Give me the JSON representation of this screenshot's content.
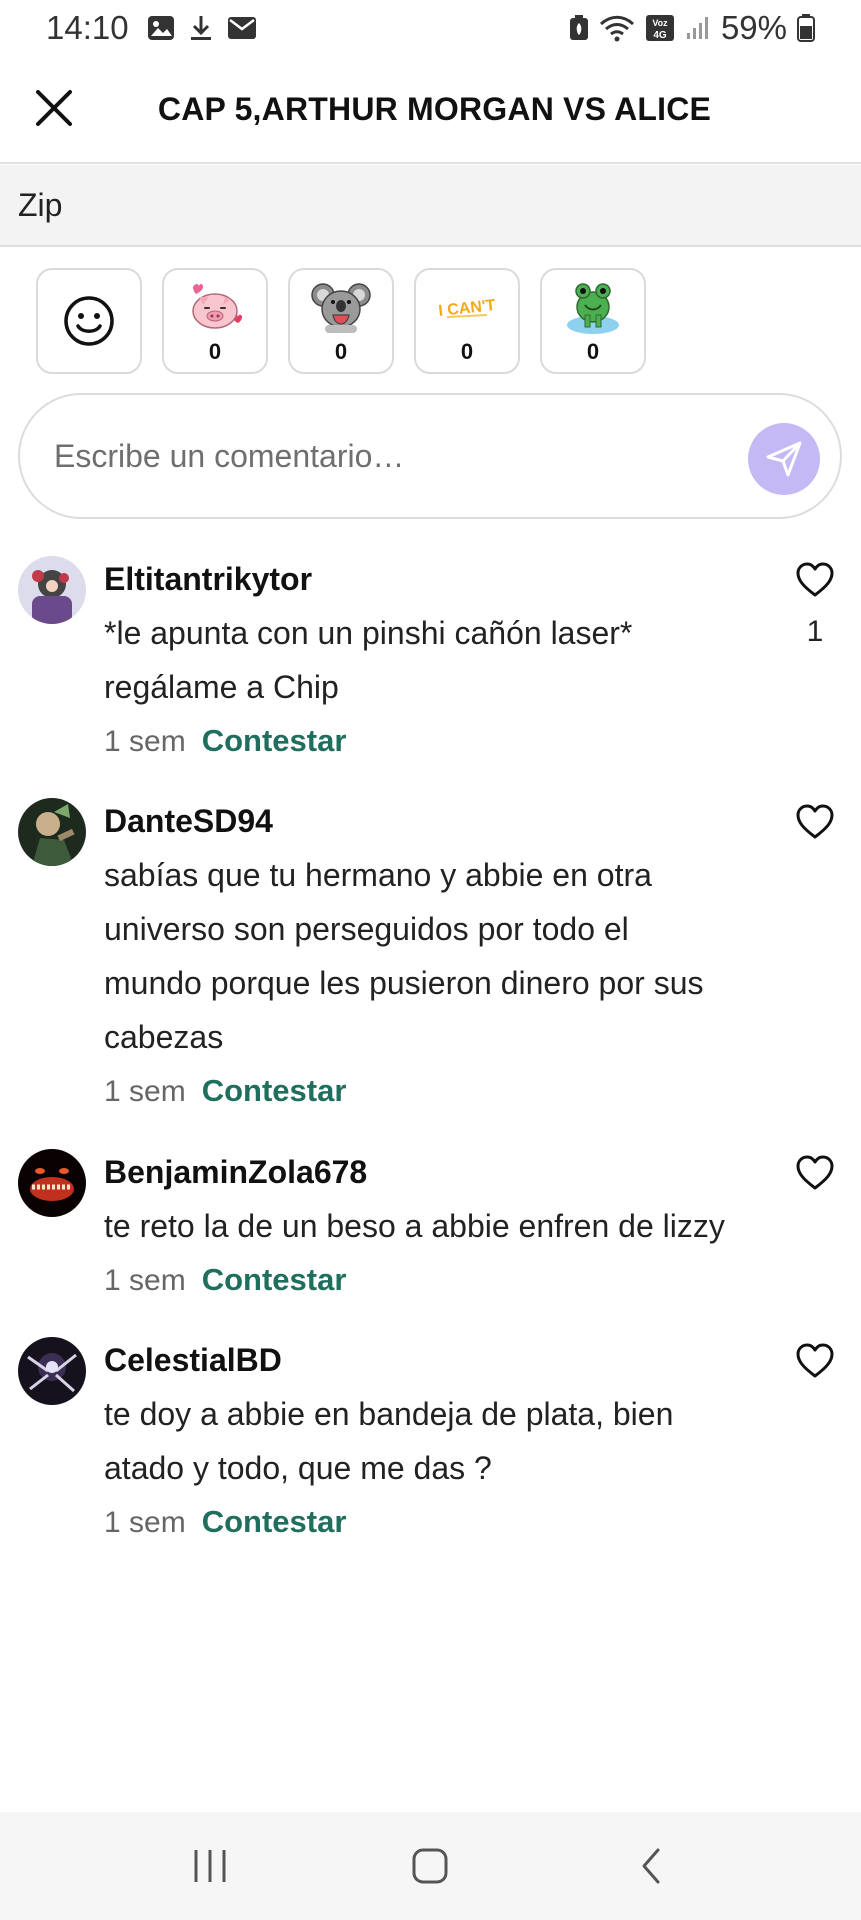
{
  "status_bar": {
    "time": "14:10",
    "battery": "59%",
    "icons": [
      "gallery-icon",
      "download-icon",
      "mail-icon",
      "battery-saver-icon",
      "wifi-icon",
      "volte-icon",
      "signal-icon",
      "battery-icon"
    ],
    "volte_label": "Voz 4G"
  },
  "header": {
    "title": "CAP 5,ARTHUR MORGAN VS ALICE",
    "close_icon": "close-icon"
  },
  "zip_bar": {
    "label": "Zip"
  },
  "stickers": [
    {
      "name": "emoji-picker",
      "count": null
    },
    {
      "name": "pig-sticker",
      "count": "0"
    },
    {
      "name": "koala-sticker",
      "count": "0"
    },
    {
      "name": "i-cant-sticker",
      "count": "0",
      "text": "I CAN'T"
    },
    {
      "name": "frog-sticker",
      "count": "0"
    }
  ],
  "comment_input": {
    "placeholder": "Escribe un comentario…",
    "send_icon": "send-icon"
  },
  "colors": {
    "reply": "#1f6e5e",
    "send_button": "#c4b9f5",
    "zip_bg": "#f3f3f3"
  },
  "comments": [
    {
      "user": "Eltitantrikytor",
      "lines": [
        "*le apunta con un pinshi cañón laser*",
        "regálame a Chip"
      ],
      "time": "1 sem",
      "reply": "Contestar",
      "likes": "1"
    },
    {
      "user": "DanteSD94",
      "lines": [
        "sabías que tu hermano y abbie en otra",
        "universo son perseguidos por todo el",
        "mundo porque les pusieron dinero por sus",
        "cabezas"
      ],
      "time": "1 sem",
      "reply": "Contestar",
      "likes": ""
    },
    {
      "user": "BenjaminZola678",
      "lines": [
        "te reto la de un beso a abbie enfren de lizzy"
      ],
      "time": "1 sem",
      "reply": "Contestar",
      "likes": ""
    },
    {
      "user": "CelestialBD",
      "lines": [
        "te doy a abbie en bandeja de plata, bien",
        "atado y todo, que me das ?"
      ],
      "time": "1 sem",
      "reply": "Contestar",
      "likes": ""
    }
  ],
  "nav_bar": [
    "recent-apps-icon",
    "home-icon",
    "back-icon"
  ]
}
